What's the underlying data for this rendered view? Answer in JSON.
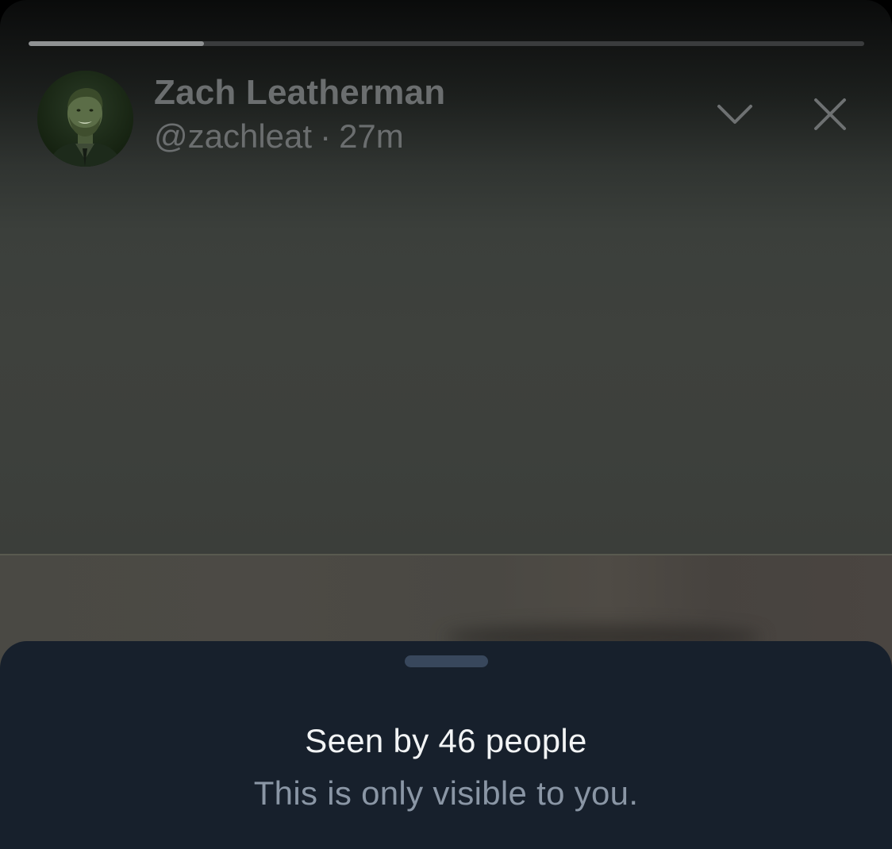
{
  "story": {
    "progress_fraction": 0.21
  },
  "author": {
    "name": "Zach Leatherman",
    "handle": "@zachleat",
    "separator": "·",
    "time_ago": "27m"
  },
  "icons": {
    "avatar": "avatar-photo",
    "collapse": "chevron-down-icon",
    "close": "close-icon"
  },
  "sheet": {
    "seen_by": "Seen by 46 people",
    "note": "This is only visible to you."
  },
  "colors": {
    "sheet_background": "#17202c",
    "primary_text": "#f2f4f5",
    "secondary_text": "#8a96a5",
    "header_text": "#6b6e6f"
  }
}
